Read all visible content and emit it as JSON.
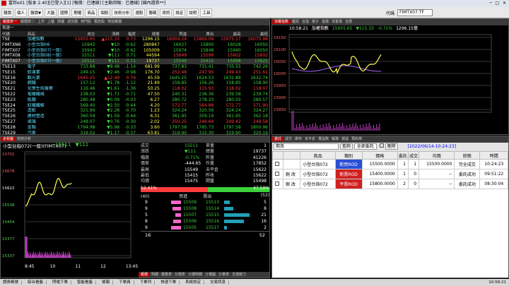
{
  "titlebar": {
    "text": "富邦e01 [版本 2.40][已登入][1] [報價：已連線] [主動回報：已連線] [國內證券**]"
  },
  "menubar": {
    "items": [
      "報價",
      "個人",
      "報價▼",
      "大盤",
      "國際",
      "期權",
      "商品",
      "個股",
      "技術分析",
      "選股",
      "籌碼",
      "資訊",
      "設定",
      "說明",
      "工具"
    ],
    "search_value": "FIMTX07.TF",
    "search_label": "代碼"
  },
  "watchlist": {
    "tabs": [
      "報價表一",
      "報價表二",
      "上市",
      "上櫃",
      "興櫃",
      "成交額",
      "熱門股",
      "概念股",
      "特別報價"
    ],
    "group": "首選一",
    "headers": [
      "代碼",
      "商品",
      "成交",
      "漲跌",
      "幅度",
      "總量",
      "買進",
      "賣出",
      "最高",
      "最低"
    ],
    "rows": [
      {
        "code": "TSE",
        "name": "加權指數",
        "price": "15955.65",
        "chg": "▲115.33",
        "pct": "0.73",
        "vol": "1296.15",
        "bid": "16004.29",
        "ask": "15869.06",
        "high": "15975.17",
        "low": "16070.98",
        "dir": "up"
      },
      {
        "code": "FIMTXN6",
        "name": "小型台指06",
        "price": "15943",
        "chg": "▼10",
        "pct": "-0.62",
        "vol": "280847",
        "bid": "16027",
        "ask": "15800",
        "high": "16028",
        "low": "16050",
        "dir": "dn"
      },
      {
        "code": "FIMTX07",
        "name": "小型台指07(一般)",
        "price": "15943",
        "chg": "▼10",
        "pct": "-0.62",
        "vol": "105009",
        "bid": "15974",
        "ask": "15848",
        "high": "15940",
        "low": "16050",
        "dir": "dn"
      },
      {
        "code": "FIMTX08",
        "name": "小型台指08(一般)",
        "price": "15511",
        "chg": "▼111",
        "pct": "0.71",
        "vol": "44594",
        "bid": "15649",
        "ask": "15599",
        "high": "15602",
        "low": "15602",
        "dir": "dn"
      },
      {
        "code": "FIMTX07",
        "name": "小型台指07(一般)",
        "price": "15511",
        "chg": "▼111",
        "pct": "0.71",
        "vol": "19737",
        "bid": "15549",
        "ask": "15415",
        "high": "15498",
        "low": "15622",
        "dir": "dn"
      },
      {
        "code": "TSE13",
        "name": "電子",
        "price": "733.88",
        "chg": "▼8.48",
        "pct": "-1.14",
        "vol": "681.99",
        "bid": "737.83",
        "ask": "731.41",
        "high": "735.55",
        "low": "742.26",
        "dir": "dn"
      },
      {
        "code": "TSE15",
        "name": "航運業",
        "price": "249.15",
        "chg": "▼2.46",
        "pct": "-0.98",
        "vol": "176.70",
        "bid": "252.48",
        "ask": "247.90",
        "high": "249.43",
        "low": "251.61",
        "dir": "dn"
      },
      {
        "code": "TSE16",
        "name": "觀光業",
        "price": "1645.25",
        "chg": "▲12.49",
        "pct": "0.76",
        "vol": "45.59",
        "bid": "1645.25",
        "ask": "1624.53",
        "high": "1632.88",
        "low": "1632.74",
        "dir": "up"
      },
      {
        "code": "TSE20",
        "name": "鋼鐵",
        "price": "157.12",
        "chg": "▼1.78",
        "pct": "-1.12",
        "vol": "21.49",
        "bid": "158.85",
        "ask": "156.26",
        "high": "158.85",
        "low": "158.90",
        "dir": "dn"
      },
      {
        "code": "TSE21",
        "name": "化學生技醫療",
        "price": "116.46",
        "chg": "▼1.61",
        "pct": "-1.36",
        "vol": "50.25",
        "bid": "118.02",
        "ask": "115.93",
        "high": "118.02",
        "low": "118.07",
        "dir": "dn"
      },
      {
        "code": "TSE22",
        "name": "電機機械",
        "price": "238.03",
        "chg": "▼1.71",
        "pct": "-0.71",
        "vol": "47.50",
        "bid": "240.31",
        "ask": "236.36",
        "high": "239.58",
        "low": "239.74",
        "dir": "dn"
      },
      {
        "code": "TSE23",
        "name": "紙類",
        "price": "280.48",
        "chg": "▼0.09",
        "pct": "-0.03",
        "vol": "6.27",
        "bid": "280.72",
        "ask": "278.33",
        "high": "280.55",
        "low": "280.57",
        "dir": "dn"
      },
      {
        "code": "TSE24",
        "name": "紡織纖維",
        "price": "569.40",
        "chg": "▼2.50",
        "pct": "-0.44",
        "vol": "4.20",
        "bid": "572.77",
        "ask": "564.88",
        "high": "572.77",
        "low": "571.90",
        "dir": "dn"
      },
      {
        "code": "TSE25",
        "name": "造紙",
        "price": "321.99",
        "chg": "▼2.28",
        "pct": "-0.70",
        "vol": "1.23",
        "bid": "324.24",
        "ask": "320.56",
        "high": "324.24",
        "low": "324.27",
        "dir": "dn"
      },
      {
        "code": "TSE26",
        "name": "建材營造",
        "price": "360.59",
        "chg": "▼1.59",
        "pct": "-0.44",
        "vol": "6.31",
        "bid": "361.95",
        "ask": "359.19",
        "high": "361.95",
        "low": "362.18",
        "dir": "dn"
      },
      {
        "code": "TSE27",
        "name": "玻璃",
        "price": "248.07",
        "chg": "▼0.76",
        "pct": "-0.30",
        "vol": "2.02",
        "bid": "250.25",
        "ask": "246.64",
        "high": "249.42",
        "low": "249.58",
        "dir": "dn"
      },
      {
        "code": "TSE28",
        "name": "金融",
        "price": "1794.98",
        "chg": "▼5.98",
        "pct": "-0.33",
        "vol": "3.60",
        "bid": "1797.58",
        "ask": "1785.73",
        "high": "1797.58",
        "low": "1800.96",
        "dir": "dn"
      },
      {
        "code": "TSE29",
        "name": "汽車",
        "price": "319.02",
        "chg": "▼1.17",
        "pct": "-0.37",
        "vol": "63.81",
        "bid": "319.90",
        "ask": "315.30",
        "high": "319.90",
        "low": "320.19",
        "dir": "dn"
      }
    ]
  },
  "index_chart": {
    "tabs": [
      "加權指數",
      "櫃買",
      "台指",
      "電子",
      "金融",
      "非金電",
      "全部"
    ],
    "time": "10:58:21",
    "name": "加權指數",
    "price": "15955.65",
    "chg": "▼115.33",
    "pct": "-0.71%",
    "vol": "1296.15億",
    "yticks": [
      "16150",
      "16100",
      "16050",
      "16000",
      "15950",
      "15900",
      "15850"
    ],
    "xticks": [
      "9",
      "10",
      "11",
      "12",
      "13:30"
    ]
  },
  "orders": {
    "tabs": [
      "委託",
      "成交",
      "庫存",
      "未平倉",
      "權益數",
      "帳務",
      "損益",
      "預約單"
    ],
    "account_label": "期貨",
    "query_button": "查詢",
    "filter_value": "全部委託",
    "delete_button": "刪除",
    "status_text": "[2022/06/14-10:24:23]",
    "headers": [
      "",
      "",
      "商品",
      "類別",
      "價格",
      "委託",
      "成交",
      "均價",
      "狀態",
      "時間"
    ],
    "rows": [
      {
        "act": "",
        "product": "小型台指072",
        "type": "新買ROD",
        "price": "15500.0000",
        "qty": "1",
        "fill": "1",
        "avg": "15500.0000",
        "status": "完全成交",
        "time": "10:24:23",
        "tc": "cy"
      },
      {
        "act": "刪 改",
        "product": "小型台指072",
        "type": "新賣ROD",
        "price": "15400.0000",
        "qty": "1",
        "fill": "0",
        "avg": "--",
        "status": "委託成功",
        "time": "09:51:22",
        "tc": "up"
      },
      {
        "act": "刪 改",
        "product": "小型台指072",
        "type": "平賣ROD",
        "price": "15800.0000",
        "qty": "2",
        "fill": "0",
        "avg": "--",
        "status": "委託成功",
        "time": "08:30:04",
        "tc": "up"
      }
    ]
  },
  "quote": {
    "tabs": [
      "走勢圖",
      "技術分析"
    ],
    "name": "小型台指072(一般)(FIMTX07)",
    "price": "15511",
    "chg": "▼111",
    "yticks": [
      "15701",
      "15678",
      "15622",
      "15538",
      "15454",
      "15377",
      "15337"
    ],
    "xticks": [
      "8:45",
      "10",
      "11",
      "12",
      "13:45"
    ],
    "detail": [
      {
        "k": "成交",
        "v": "15511",
        "k2": "單量",
        "v2": "1"
      },
      {
        "k": "漲跌",
        "v": "▼111",
        "k2": "總量",
        "v2": "19737"
      },
      {
        "k": "幅度",
        "v": "-0.71%",
        "k2": "昨量",
        "v2": "41226"
      },
      {
        "k": "價差",
        "v": "-444.65",
        "k2": "作量",
        "v2": "17852"
      },
      {
        "k": "最高",
        "v": "15549",
        "k2": "未平倉",
        "v2": "15622"
      },
      {
        "k": "最低",
        "v": "15415",
        "k2": "昨收",
        "v2": "15622"
      },
      {
        "k": "均價",
        "v": "15475",
        "k2": "開盤",
        "v2": "15498"
      }
    ],
    "buy_pct": "52.41%",
    "sell_pct": "47.59%",
    "book_left": "(40)",
    "book_right": "(52)",
    "book_hdr_bid": "買進",
    "book_hdr_ask": "賣出",
    "book": [
      {
        "bq": "9",
        "bp": "15509",
        "ap": "15513",
        "aq": "5",
        "bw": 0.45,
        "aw": 0.22
      },
      {
        "bq": "9",
        "bp": "15508",
        "ap": "15514",
        "aq": "8",
        "bw": 0.4,
        "aw": 0.35
      },
      {
        "bq": "5",
        "bp": "15507",
        "ap": "15515",
        "aq": "21",
        "bw": 0.25,
        "aw": 1.0
      },
      {
        "bq": "8",
        "bp": "15506",
        "ap": "15516",
        "aq": "16",
        "bw": 0.38,
        "aw": 0.78
      },
      {
        "bq": "9",
        "bp": "15505",
        "ap": "15517",
        "aq": "2",
        "bw": 0.45,
        "aw": 0.1
      }
    ],
    "total_bid": "16",
    "total_ask": "52",
    "bottom_tabs": [
      "報價",
      "明細",
      "價量表",
      "分價表",
      "分價明細",
      "分價圖",
      "分量表",
      "支撐壓力"
    ]
  },
  "statusbar": {
    "items": [
      "證券帳號",
      "綜合看盤",
      "閃電下單",
      "智能看盤",
      "條報",
      "下單員",
      "下單列",
      "快速下單",
      "系統設定",
      "交易訊息"
    ],
    "clock": "10:58:21"
  },
  "colors": {
    "up": "#ff3c3c",
    "down": "#3cd23c",
    "accent": "#b40000",
    "line": "#ffff50"
  }
}
